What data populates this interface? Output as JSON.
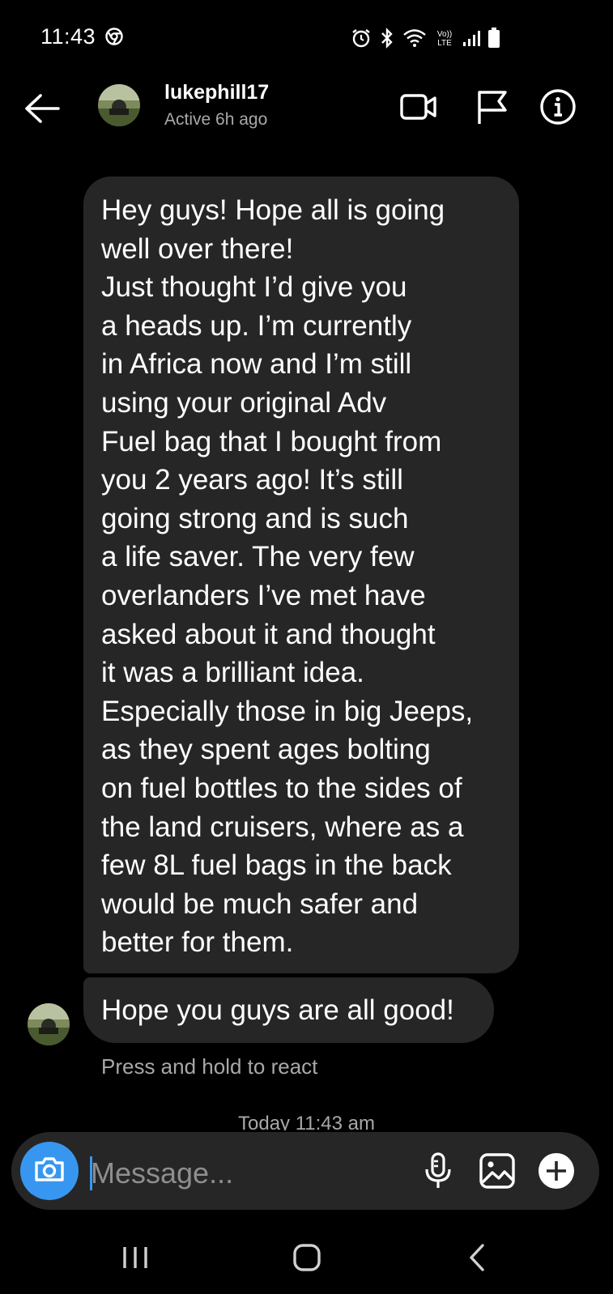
{
  "status_bar": {
    "time": "11:43",
    "icons": [
      "chrome-icon",
      "alarm-icon",
      "bluetooth-icon",
      "wifi-icon",
      "volte-icon",
      "signal-icon",
      "battery-icon"
    ]
  },
  "header": {
    "username": "lukephill17",
    "status": "Active 6h ago",
    "icons": [
      "back-arrow-icon",
      "video-call-icon",
      "flag-icon",
      "info-icon"
    ]
  },
  "messages": [
    {
      "text": "Hey guys! Hope all is going\nwell over there!\nJust thought I’d give you\na heads up. I’m currently\nin Africa now and I’m still\nusing your original Adv\nFuel bag that I bought from\nyou 2 years ago! It’s still\ngoing strong and is such\na life saver. The very few\noverlanders I’ve met have\nasked about it and thought\nit was a brilliant idea.\nEspecially those in big Jeeps,\nas they spent ages bolting\non fuel bottles to the sides of\nthe land cruisers, where as a\nfew 8L fuel bags in the back\nwould be much safer and\nbetter for them."
    },
    {
      "text": "Hope you guys are all good!"
    }
  ],
  "react_hint": "Press and hold to react",
  "timestamp": "Today 11:43 am",
  "composer": {
    "placeholder": "Message...",
    "icons": [
      "camera-icon",
      "microphone-icon",
      "gallery-icon",
      "add-icon"
    ]
  },
  "colors": {
    "accent": "#3797f0",
    "bubble": "#262626",
    "background": "#000000",
    "secondary_text": "#a8a8a8"
  }
}
